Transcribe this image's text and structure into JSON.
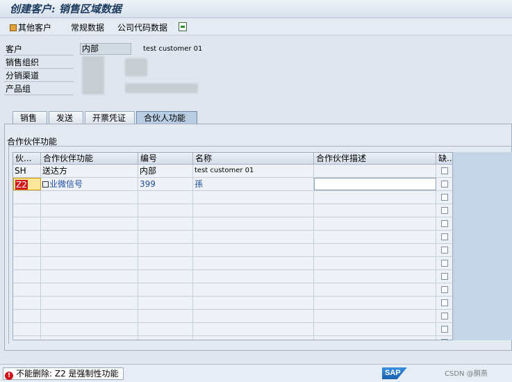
{
  "title": "创建客户: 销售区域数据",
  "toolbar": {
    "other_customer": "其他客户",
    "general_data": "常规数据",
    "company_code_data": "公司代码数据"
  },
  "header": {
    "customer_label": "客户",
    "customer_value": "内部",
    "customer_desc": "test customer 01",
    "sales_org_label": "销售组织",
    "dist_channel_label": "分销渠道",
    "division_label": "产品组"
  },
  "tabs": [
    "销售",
    "发送",
    "开票凭证",
    "合伙人功能"
  ],
  "group_title": "合作伙伴功能",
  "grid": {
    "headers": [
      "伙...",
      "合作伙伴功能",
      "编号",
      "名称",
      "合作伙伴描述",
      "缺.."
    ],
    "rows": [
      {
        "pf": "SH",
        "function": "送达方",
        "number": "内部",
        "name": "test customer 01",
        "desc": ""
      },
      {
        "pf": "Z2",
        "function": "业微信号",
        "number": "399",
        "name": "孫",
        "desc": ""
      }
    ]
  },
  "status": {
    "message": "不能删除: Z2 是强制性功能",
    "brand": "SAP",
    "watermark": "CSDN @胴燕"
  }
}
